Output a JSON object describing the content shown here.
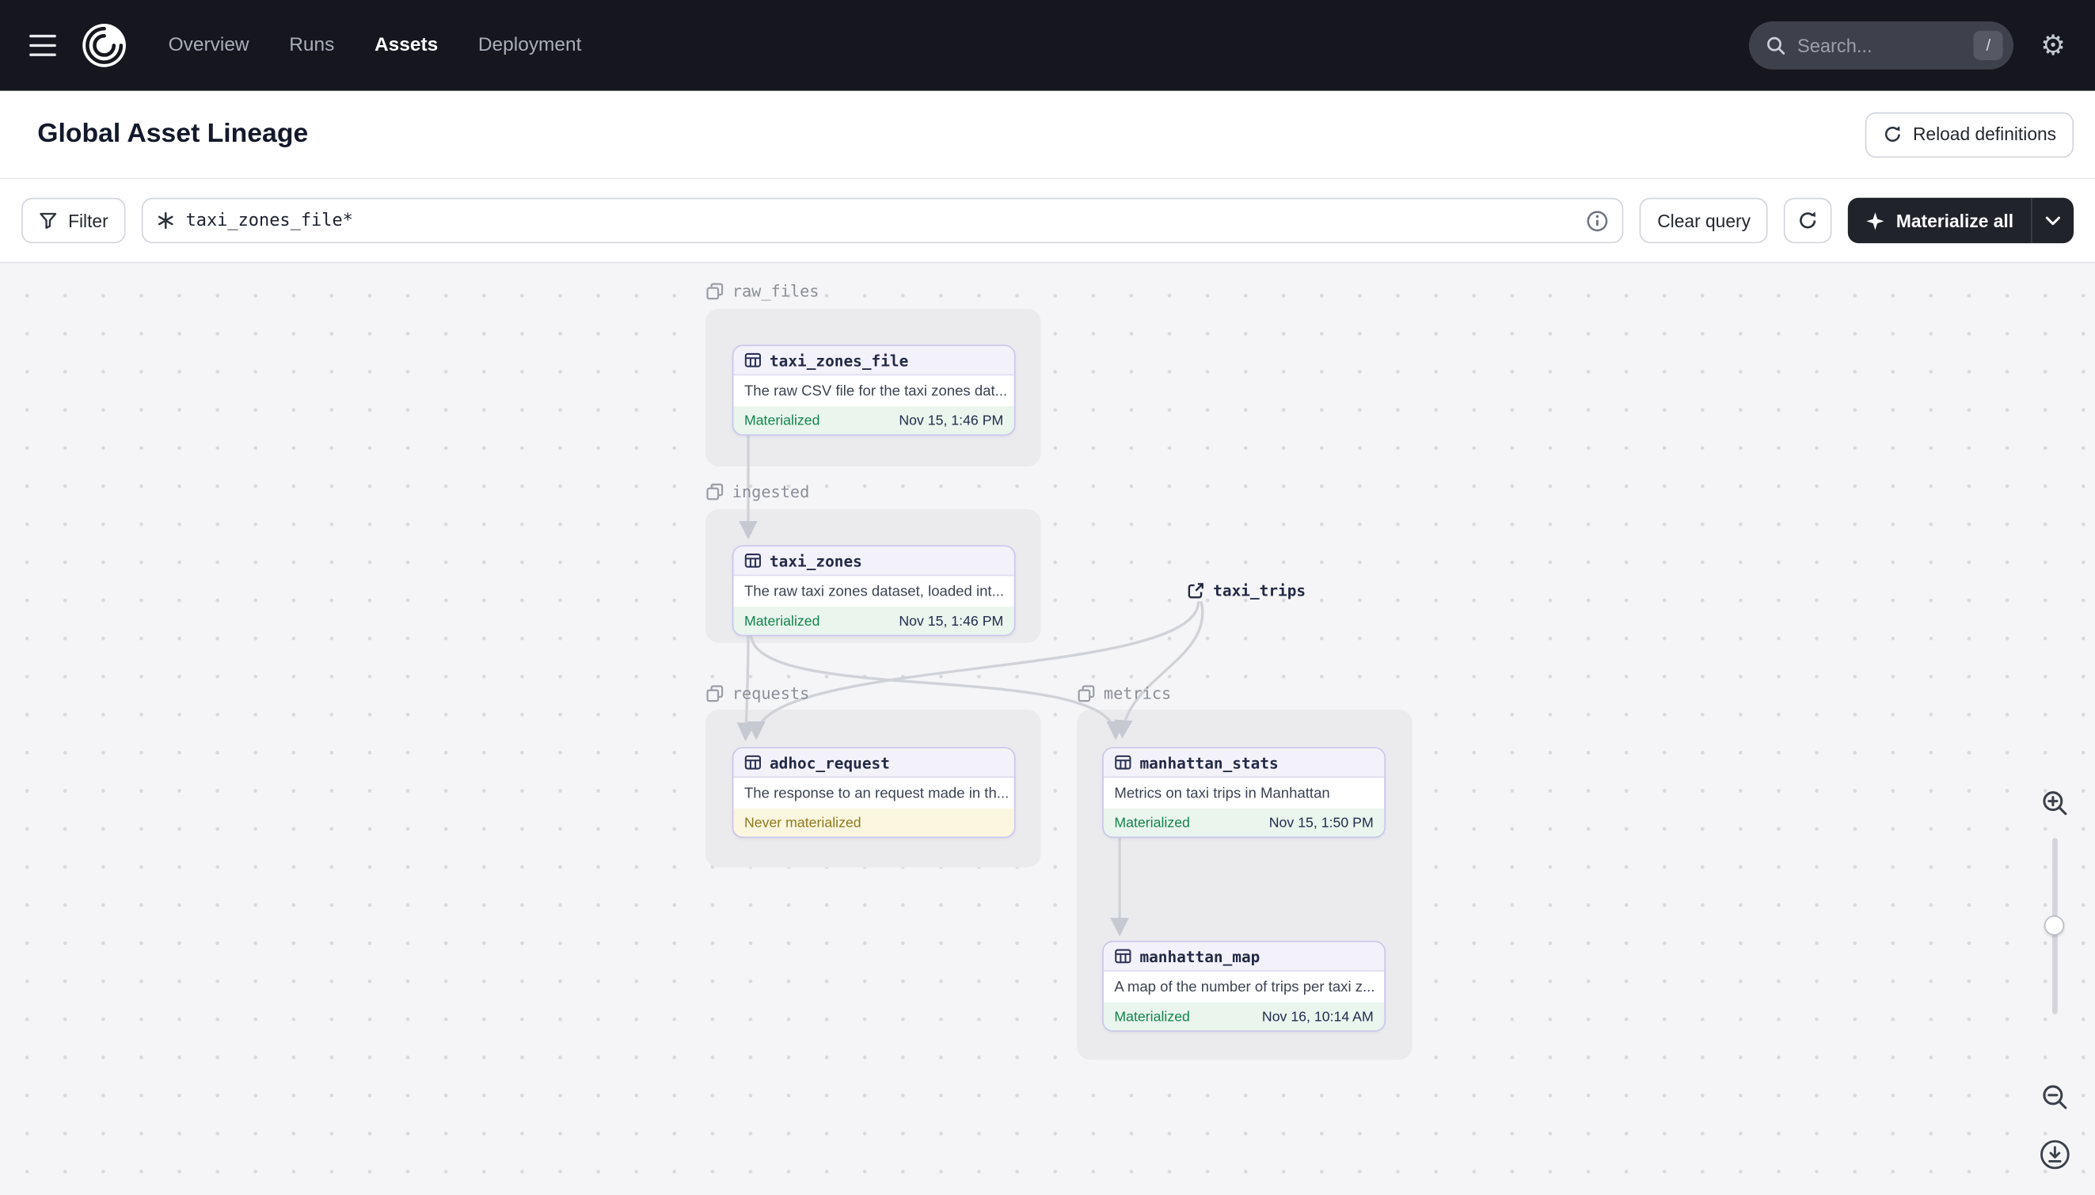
{
  "navbar": {
    "links": [
      {
        "label": "Overview"
      },
      {
        "label": "Runs"
      },
      {
        "label": "Assets"
      },
      {
        "label": "Deployment"
      }
    ],
    "active_link": "Assets",
    "search": {
      "placeholder": "Search...",
      "shortcut": "/"
    },
    "settings_glyph": "⚙"
  },
  "header": {
    "title": "Global Asset Lineage",
    "reload_label": "Reload definitions"
  },
  "toolbar": {
    "filter_label": "Filter",
    "query_value": "taxi_zones_file*",
    "clear_label": "Clear query",
    "materialize_label": "Materialize all"
  },
  "graph": {
    "groups": [
      {
        "name": "raw_files"
      },
      {
        "name": "ingested"
      },
      {
        "name": "requests"
      },
      {
        "name": "metrics"
      }
    ],
    "nodes": [
      {
        "name": "taxi_zones_file",
        "group": "raw_files",
        "description": "The raw CSV file for the taxi zones dat...",
        "status": "Materialized",
        "timestamp": "Nov 15, 1:46 PM"
      },
      {
        "name": "taxi_zones",
        "group": "ingested",
        "description": "The raw taxi zones dataset, loaded int...",
        "status": "Materialized",
        "timestamp": "Nov 15, 1:46 PM"
      },
      {
        "name": "adhoc_request",
        "group": "requests",
        "description": "The response to an request made in th...",
        "status": "Never materialized",
        "timestamp": ""
      },
      {
        "name": "manhattan_stats",
        "group": "metrics",
        "description": "Metrics on taxi trips in Manhattan",
        "status": "Materialized",
        "timestamp": "Nov 15, 1:50 PM"
      },
      {
        "name": "manhattan_map",
        "group": "metrics",
        "description": "A map of the number of trips per taxi z...",
        "status": "Materialized",
        "timestamp": "Nov 16, 10:14 AM"
      }
    ],
    "external_nodes": [
      {
        "name": "taxi_trips"
      }
    ],
    "edges": [
      [
        "taxi_zones_file",
        "taxi_zones"
      ],
      [
        "taxi_zones",
        "adhoc_request"
      ],
      [
        "taxi_zones",
        "manhattan_stats"
      ],
      [
        "taxi_trips",
        "adhoc_request"
      ],
      [
        "taxi_trips",
        "manhattan_stats"
      ],
      [
        "manhattan_stats",
        "manhattan_map"
      ]
    ]
  },
  "colors": {
    "navbar_bg": "#15161e",
    "materialize_button_bg": "#21232b",
    "card_border": "#c9c6ec",
    "card_header_bg": "#f3f1fa",
    "materialized_bg": "#e9f5ed",
    "materialized_text": "#14854c",
    "never_materialized_bg": "#fbf6df",
    "never_materialized_text": "#8f7a1f",
    "canvas_bg": "#f5f5f7",
    "edge": "#d0d2d8"
  },
  "icons": {
    "menu": "hamburger",
    "logo": "dagster-swirl",
    "search": "magnifier",
    "settings": "gear",
    "reload": "circular-arrow",
    "filter": "funnel",
    "query": "asterisk",
    "info": "info-circle",
    "refresh": "circular-arrow",
    "materialize": "sparkle",
    "dropdown": "chevron-down",
    "group": "stacked-squares",
    "asset": "table-grid",
    "external": "external-link",
    "zoom_in": "magnifier-plus",
    "zoom_out": "magnifier-minus",
    "export": "download-circle"
  }
}
